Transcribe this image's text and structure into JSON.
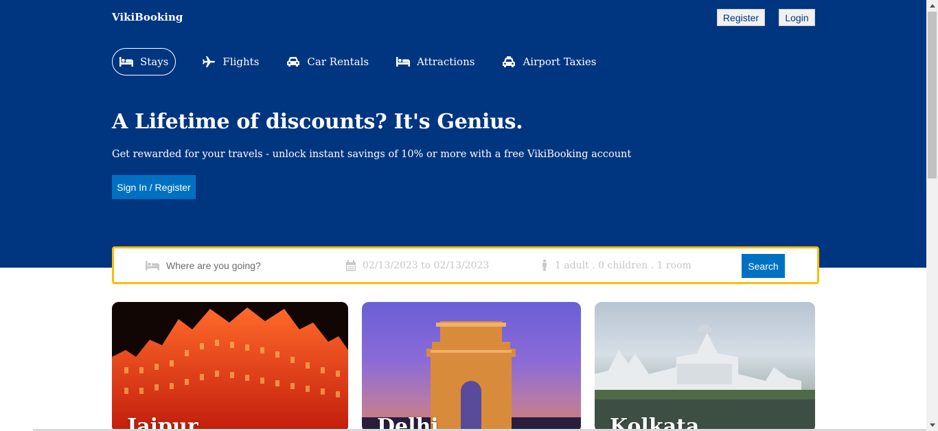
{
  "header": {
    "logo": "VikiBooking",
    "register_label": "Register",
    "login_label": "Login"
  },
  "nav": {
    "items": [
      {
        "label": "Stays",
        "icon": "bed-icon",
        "active": true
      },
      {
        "label": "Flights",
        "icon": "plane-icon"
      },
      {
        "label": "Car Rentals",
        "icon": "car-icon"
      },
      {
        "label": "Attractions",
        "icon": "bed-icon"
      },
      {
        "label": "Airport Taxies",
        "icon": "taxi-icon"
      }
    ]
  },
  "hero": {
    "title": "A Lifetime of discounts? It's Genius.",
    "description": "Get rewarded for your travels - unlock instant savings of 10% or more with a free VikiBooking account",
    "cta_label": "Sign In / Register"
  },
  "search": {
    "destination_placeholder": "Where are you going?",
    "dates": "02/13/2023 to 02/13/2023",
    "options": "1 adult . 0 children . 1 room",
    "button_label": "Search"
  },
  "cards": [
    {
      "title": "Jaipur"
    },
    {
      "title": "Delhi"
    },
    {
      "title": "Kolkata"
    }
  ],
  "colors": {
    "hero_bg": "#003580",
    "primary_button": "#0071c2",
    "search_border": "#febb02"
  }
}
